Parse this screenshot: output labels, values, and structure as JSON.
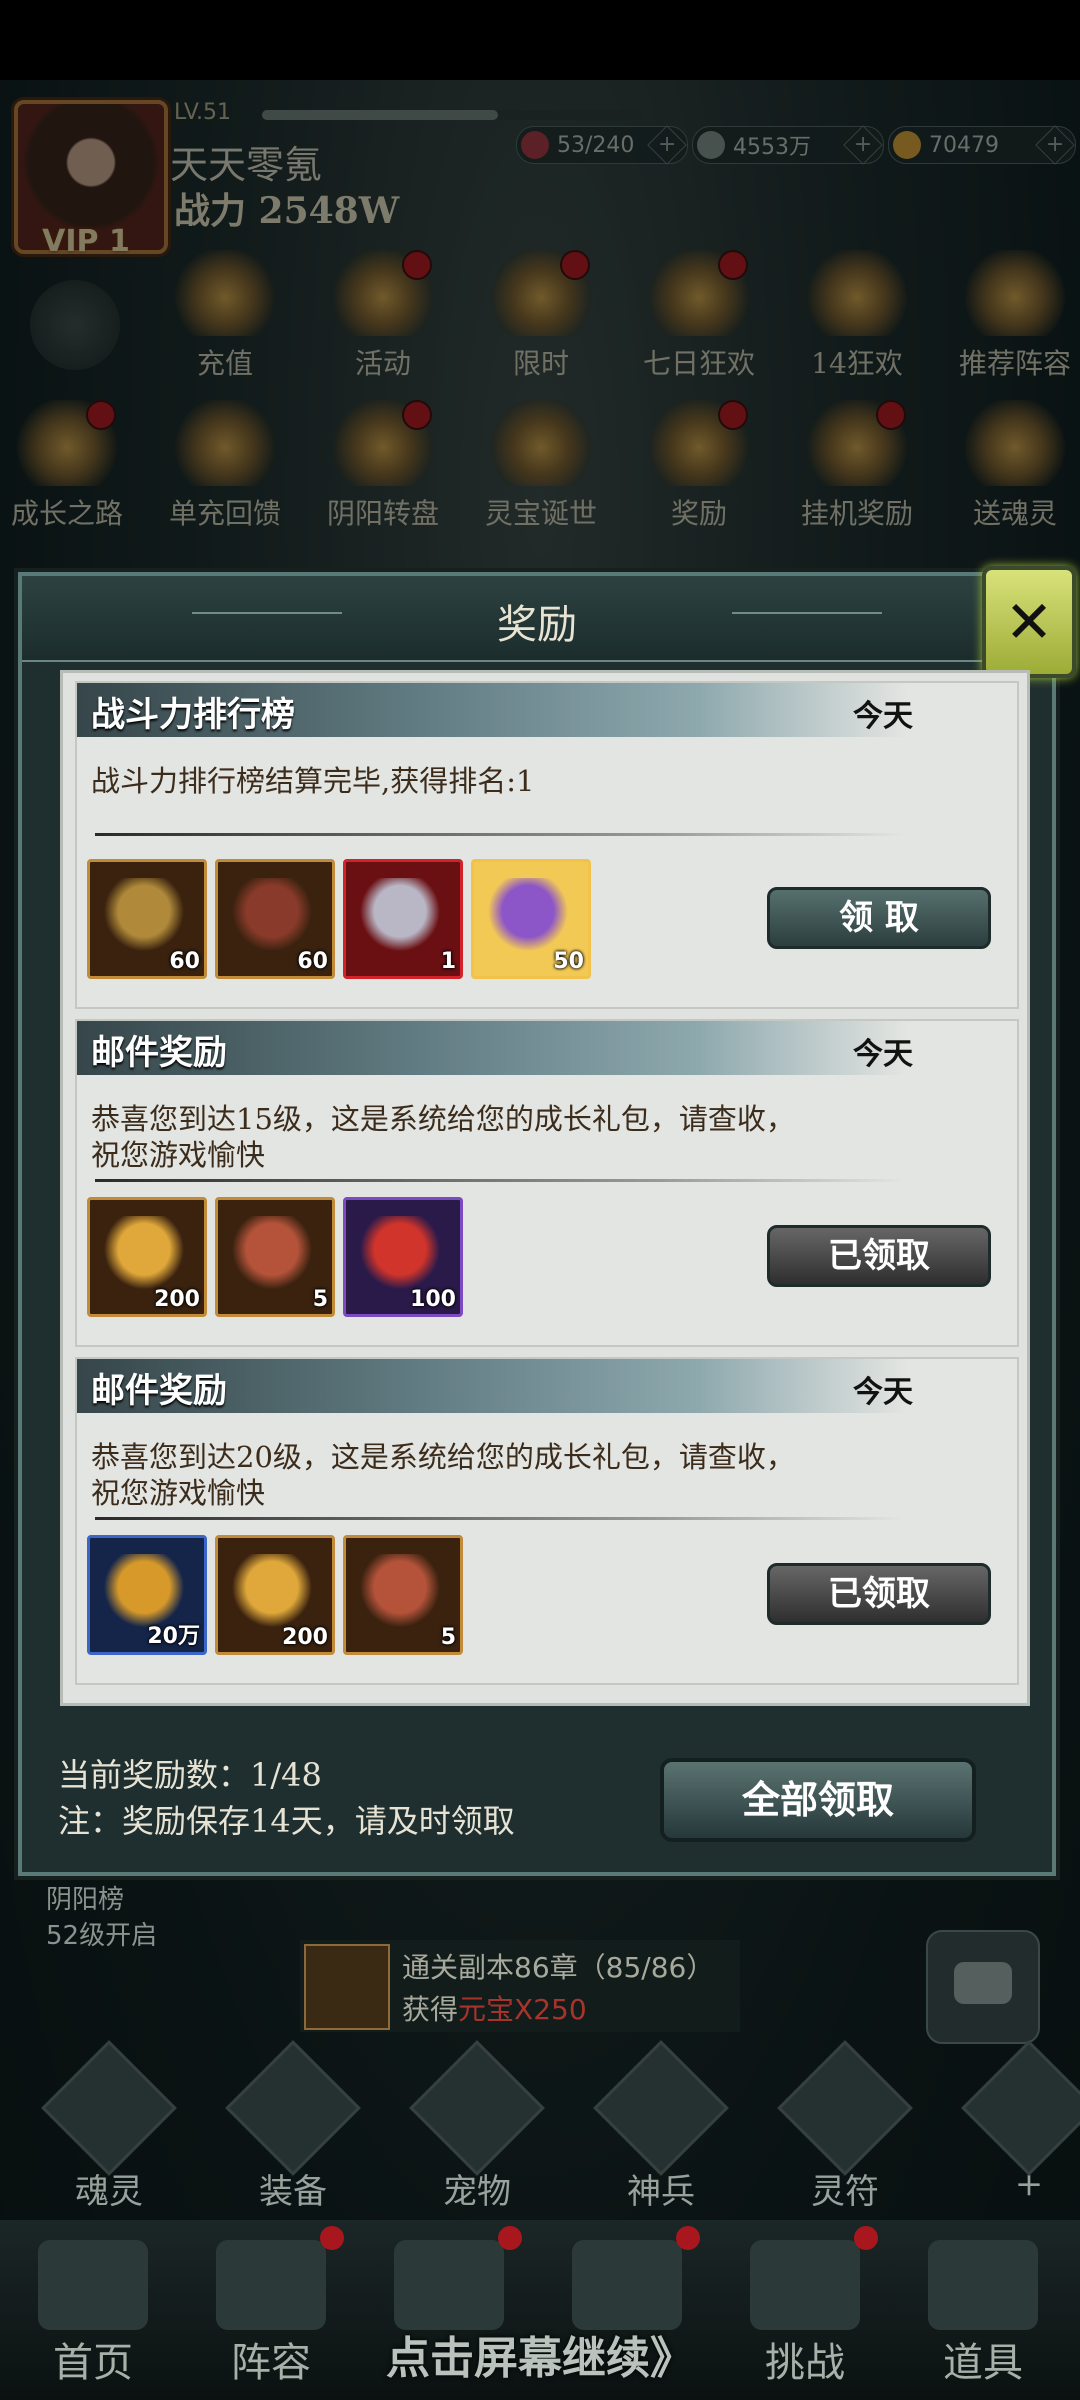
{
  "player": {
    "level": "LV.51",
    "level_progress": 0.62,
    "name": "天天零氪",
    "power": "战力 2548W",
    "vip": "VIP 1"
  },
  "resources": [
    {
      "name": "stamina",
      "value": "53/240",
      "color": "#a3343c"
    },
    {
      "name": "silver",
      "value": "4553万",
      "color": "#7f8b86"
    },
    {
      "name": "gold",
      "value": "70479",
      "color": "#d49b32"
    }
  ],
  "features_row1": [
    {
      "label": "充值",
      "dot": false
    },
    {
      "label": "活动",
      "dot": true
    },
    {
      "label": "限时",
      "dot": true
    },
    {
      "label": "七日狂欢",
      "dot": true
    },
    {
      "label": "14狂欢",
      "dot": false
    },
    {
      "label": "推荐阵容",
      "dot": false
    }
  ],
  "features_row2": [
    {
      "label": "成长之路",
      "dot": true
    },
    {
      "label": "单充回馈",
      "dot": false
    },
    {
      "label": "阴阳转盘",
      "dot": true
    },
    {
      "label": "灵宝诞世",
      "dot": false
    },
    {
      "label": "奖励",
      "dot": true
    },
    {
      "label": "挂机奖励",
      "dot": true
    },
    {
      "label": "送魂灵",
      "dot": false
    }
  ],
  "dialog": {
    "title": "奖励",
    "close_icon": "close-icon",
    "cards": [
      {
        "title": "战斗力排行榜",
        "date": "今天",
        "message": "战斗力排行榜结算完毕,获得排名:1",
        "items": [
          {
            "icon": "treasure-chest-icon",
            "count": "60",
            "border": "#c18b3a",
            "bg": "#3a220f",
            "art": "#b08a3a"
          },
          {
            "icon": "key-icon",
            "count": "60",
            "border": "#c18b3a",
            "bg": "#3a220f",
            "art": "#8a3a2a"
          },
          {
            "icon": "title-scroll-icon",
            "count": "1",
            "border": "#d2232a",
            "bg": "#6a0f12",
            "art": "#b9b7c6"
          },
          {
            "icon": "purple-crown-icon",
            "count": "50",
            "border": "#f2c24a",
            "bg": "#f3c956",
            "art": "#8c55c8"
          }
        ],
        "button": "领 取",
        "claimed": false
      },
      {
        "title": "邮件奖励",
        "date": "今天",
        "message": "恭喜您到达15级，这是系统给您的成长礼包，请查收，祝您游戏愉快",
        "items": [
          {
            "icon": "gold-ingot-icon",
            "count": "200",
            "border": "#c18b3a",
            "bg": "#3a220f",
            "art": "#e0a83a"
          },
          {
            "icon": "fire-orb-icon",
            "count": "5",
            "border": "#c18b3a",
            "bg": "#3a220f",
            "art": "#b5533a"
          },
          {
            "icon": "red-orb-icon",
            "count": "100",
            "border": "#7c4bc2",
            "bg": "#2a1a4a",
            "art": "#d0342a"
          }
        ],
        "button": "已领取",
        "claimed": true
      },
      {
        "title": "邮件奖励",
        "date": "今天",
        "message": "恭喜您到达20级，这是系统给您的成长礼包，请查收，祝您游戏愉快",
        "items": [
          {
            "icon": "copper-coin-icon",
            "count": "20万",
            "border": "#3a66c8",
            "bg": "#15254a",
            "art": "#d79a2a"
          },
          {
            "icon": "gold-ingot-icon",
            "count": "200",
            "border": "#c18b3a",
            "bg": "#3a220f",
            "art": "#e0a83a"
          },
          {
            "icon": "fire-orb-icon",
            "count": "5",
            "border": "#c18b3a",
            "bg": "#3a220f",
            "art": "#b5533a"
          }
        ],
        "button": "已领取",
        "claimed": true
      }
    ],
    "reward_count": "当前奖励数：1/48",
    "note": "注：奖励保存14天，请及时领取",
    "claim_all": "全部领取"
  },
  "rank_lock": {
    "line1": "阴阳榜",
    "line2": "52级开启"
  },
  "quest": {
    "line1": "通关副本86章（85/86）",
    "line2_prefix": "获得",
    "line2_reward": "元宝X250"
  },
  "secondary_nav": [
    "魂灵",
    "装备",
    "宠物",
    "神兵",
    "灵符",
    "+"
  ],
  "bottom_tabs": [
    "首页",
    "阵容",
    "",
    "",
    "挑战",
    "道具"
  ],
  "continue_hint": "点击屏幕继续》"
}
